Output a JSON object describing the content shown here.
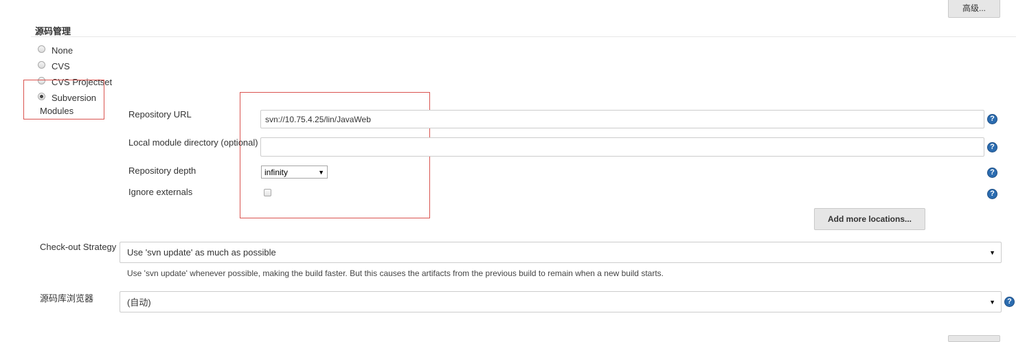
{
  "header": {
    "advanced_button": "高级..."
  },
  "scm": {
    "title": "源码管理",
    "options": [
      {
        "label": "None",
        "checked": false
      },
      {
        "label": "CVS",
        "checked": false
      },
      {
        "label": "CVS Projectset",
        "checked": false
      },
      {
        "label": "Subversion",
        "checked": true
      }
    ],
    "modules_label": "Modules"
  },
  "svn": {
    "repo_url_label": "Repository URL",
    "repo_url_value": "svn://10.75.4.25/lin/JavaWeb",
    "local_dir_label": "Local module directory (optional)",
    "local_dir_value": "",
    "depth_label": "Repository depth",
    "depth_value": "infinity",
    "ignore_externals_label": "Ignore externals",
    "ignore_externals_checked": false,
    "add_locations_button": "Add more locations..."
  },
  "checkout": {
    "label": "Check-out Strategy",
    "value": "Use 'svn update' as much as possible",
    "description": "Use 'svn update' whenever possible, making the build faster. But this causes the artifacts from the previous build to remain when a new build starts."
  },
  "browser": {
    "label": "源码库浏览器",
    "value": "(自动)"
  },
  "help_icon": {
    "glyph": "?"
  },
  "colors": {
    "highlight": "#d9534f",
    "help": "#2b6cb0"
  }
}
